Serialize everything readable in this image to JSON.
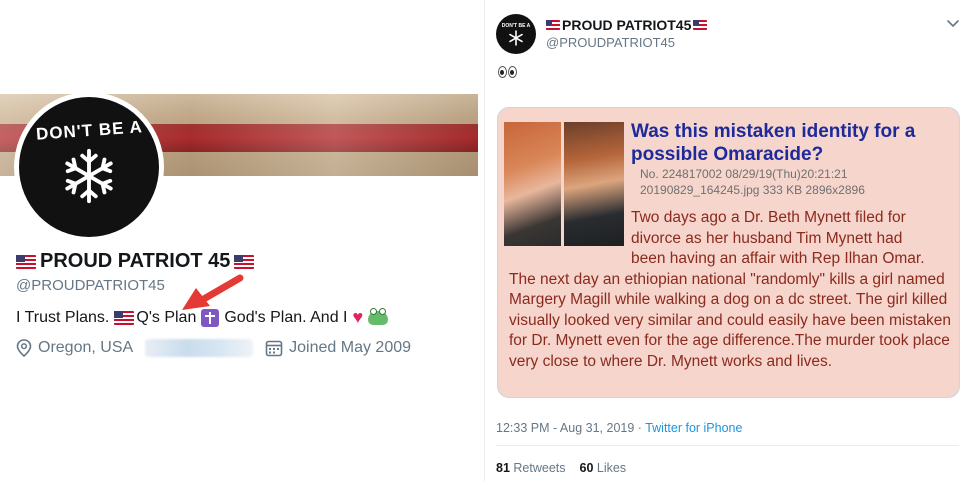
{
  "profile": {
    "avatar_text": "DON'T BE A",
    "display_name": "PROUD PATRIOT 45",
    "handle": "@PROUDPATRIOT45",
    "bio": {
      "part1": "I Trust Plans.",
      "part2": "Q's Plan",
      "part3": "God's Plan. And I"
    },
    "location": "Oregon, USA",
    "joined": "Joined May 2009"
  },
  "tweet": {
    "avatar_text": "DON'T BE A",
    "display_name": "PROUD PATRIOT45",
    "handle": "@PROUDPATRIOT45",
    "card": {
      "title_line1": "Was this mistaken identity for a",
      "title_line2": "possible Omaracide?",
      "meta_line1": "No. 224817002 08/29/19(Thu)20:21:21",
      "meta_line2": "20190829_164245.jpg 333 KB 2896x2896",
      "body_indented": [
        "Two days ago a Dr. Beth Mynett filed for",
        "divorce as her husband Tim Mynett had",
        "been having an affair with Rep Ilhan Omar."
      ],
      "body_full": "The next day an ethiopian national \"randomly\" kills a girl named Margery Magill while walking a dog on a dc street. The girl killed visually looked very similar and could easily have been mistaken for Dr. Mynett even for the age difference.The murder took place very close to where Dr. Mynett works and lives."
    },
    "time": "12:33 PM - Aug 31, 2019",
    "separator": " · ",
    "source": "Twitter for iPhone",
    "retweets_count": "81",
    "retweets_label": "Retweets",
    "likes_count": "60",
    "likes_label": "Likes"
  },
  "colors": {
    "link_blue": "#1b95e0",
    "card_bg": "#f5d5cc",
    "card_title": "#1e2a9a",
    "card_body": "#8b2a1e",
    "arrow_red": "#e53935"
  },
  "icons": [
    "snowflake-icon",
    "us-flag-icon",
    "latin-cross-icon",
    "heart-icon",
    "frog-icon",
    "location-pin-icon",
    "calendar-icon",
    "eyes-icon",
    "chevron-down-icon",
    "red-arrow-annotation"
  ]
}
